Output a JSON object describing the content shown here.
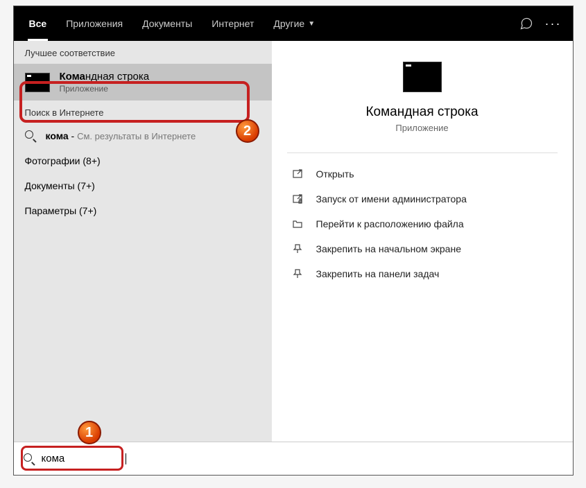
{
  "header": {
    "tabs": [
      {
        "label": "Все",
        "active": true
      },
      {
        "label": "Приложения"
      },
      {
        "label": "Документы"
      },
      {
        "label": "Интернет"
      },
      {
        "label": "Другие",
        "dropdown": true
      }
    ]
  },
  "left": {
    "best_match_header": "Лучшее соответствие",
    "best_match": {
      "title_bold": "Кома",
      "title_rest": "ндная строка",
      "subtitle": "Приложение"
    },
    "web_header": "Поиск в Интернете",
    "web_row": {
      "bold": "кома",
      "separator": " - ",
      "hint": "См. результаты в Интернете"
    },
    "categories": [
      {
        "label": "Фотографии (8+)"
      },
      {
        "label": "Документы (7+)"
      },
      {
        "label": "Параметры (7+)"
      }
    ]
  },
  "right": {
    "title": "Командная строка",
    "subtitle": "Приложение",
    "actions": [
      {
        "icon": "open",
        "label": "Открыть"
      },
      {
        "icon": "admin",
        "label": "Запуск от имени администратора"
      },
      {
        "icon": "folder",
        "label": "Перейти к расположению файла"
      },
      {
        "icon": "pin-start",
        "label": "Закрепить на начальном экране"
      },
      {
        "icon": "pin-task",
        "label": "Закрепить на панели задач"
      }
    ]
  },
  "search": {
    "value": "кома"
  },
  "annotations": {
    "one": "1",
    "two": "2"
  }
}
